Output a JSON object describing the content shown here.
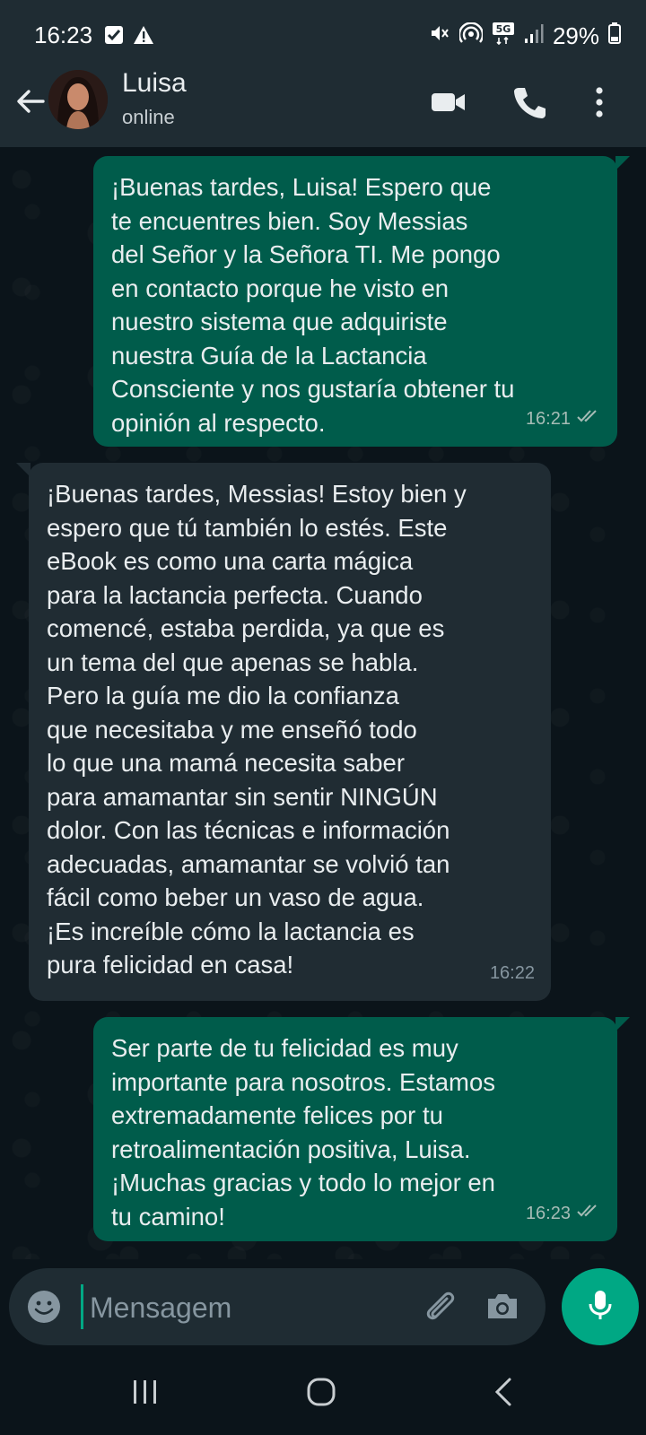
{
  "status_bar": {
    "time": "16:23",
    "battery": "29%",
    "left_icons": [
      "checkbox-icon",
      "warning-icon"
    ],
    "right_icons": [
      "mute-icon",
      "hotspot-icon",
      "network-5g-icon",
      "signal-icon",
      "battery-icon"
    ]
  },
  "header": {
    "contact_name": "Luisa",
    "contact_status": "online",
    "actions": [
      "video-call-icon",
      "voice-call-icon",
      "more-options-icon"
    ]
  },
  "messages": [
    {
      "direction": "outgoing",
      "text": "¡Buenas tardes, Luisa! Espero que\nte encuentres bien. Soy Messias\ndel Señor y la Señora TI. Me pongo\nen contacto porque he visto en\nnuestro sistema que adquiriste\nnuestra Guía de la Lactancia\nConsciente y nos gustaría obtener tu\nopinión al respecto.",
      "time": "16:21",
      "status": "read"
    },
    {
      "direction": "incoming",
      "text": "¡Buenas tardes, Messias! Estoy bien y\nespero que tú también lo estés. Este\neBook es como una carta mágica\npara la lactancia perfecta. Cuando\ncomencé, estaba perdida, ya que es\nun tema del que apenas se habla.\nPero la guía me dio la confianza\nque necesitaba y me enseñó todo\nlo que una mamá necesita saber\npara amamantar sin sentir NINGÚN\ndolor. Con las técnicas e información\nadecuadas, amamantar se volvió tan\nfácil como beber un vaso de agua.\n¡Es increíble cómo la lactancia es\npura felicidad en casa!",
      "time": "16:22"
    },
    {
      "direction": "outgoing",
      "text": "Ser parte de tu felicidad es muy\nimportante para nosotros. Estamos\nextremadamente felices por tu\nretroalimentación positiva, Luisa.\n¡Muchas gracias y todo lo mejor en\ntu camino!",
      "time": "16:23",
      "status": "read"
    }
  ],
  "composer": {
    "placeholder": "Mensagem",
    "icons": [
      "emoji-icon",
      "attach-icon",
      "camera-icon",
      "mic-icon"
    ]
  },
  "navbar": {
    "buttons": [
      "recent-apps-icon",
      "home-icon",
      "back-nav-icon"
    ]
  },
  "colors": {
    "background": "#0b141a",
    "header": "#1f2c33",
    "outgoing_bubble": "#005c4b",
    "incoming_bubble": "#202c33",
    "accent": "#00a884",
    "read_ticks": "#a6bcb6"
  }
}
